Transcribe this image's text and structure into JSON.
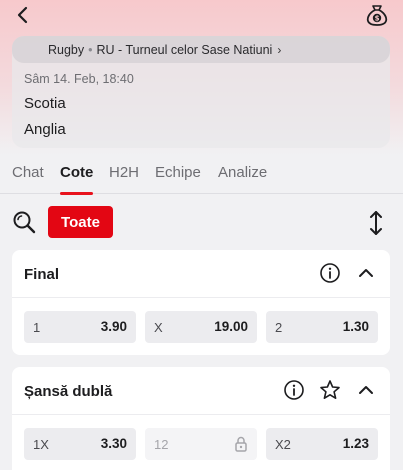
{
  "header": {
    "back_icon": "chevron-left-icon",
    "wallet_icon": "money-bag-icon"
  },
  "match": {
    "sport": "Rugby",
    "competition": "RU - Turneul celor Sase Natiuni",
    "date": "Sâm 14. Feb, 18:40",
    "home_team": "Scotia",
    "away_team": "Anglia"
  },
  "tabs": [
    {
      "label": "Chat",
      "active": false
    },
    {
      "label": "Cote",
      "active": true
    },
    {
      "label": "H2H",
      "active": false
    },
    {
      "label": "Echipe",
      "active": false
    },
    {
      "label": "Analize",
      "active": false
    }
  ],
  "filter": {
    "all_label": "Toate",
    "accent_color": "#e30613"
  },
  "markets": [
    {
      "title": "Final",
      "odds": [
        {
          "label": "1",
          "value": "3.90"
        },
        {
          "label": "X",
          "value": "19.00"
        },
        {
          "label": "2",
          "value": "1.30"
        }
      ]
    },
    {
      "title": "Șansă dublă",
      "odds": [
        {
          "label": "1X",
          "value": "3.30"
        },
        {
          "label": "12",
          "value": "",
          "locked": true
        },
        {
          "label": "X2",
          "value": "1.23"
        }
      ]
    }
  ]
}
